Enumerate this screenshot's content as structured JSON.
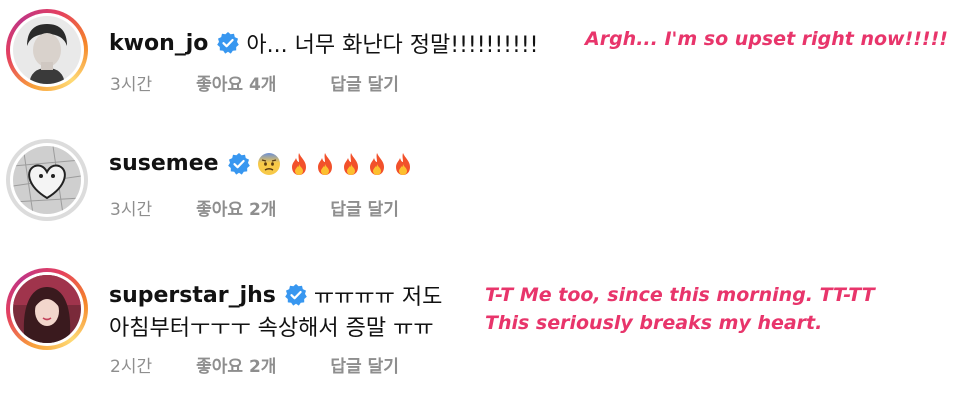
{
  "comments": [
    {
      "username": "kwon_jo",
      "text": "아... 너무 화난다  정말!!!!!!!!!!",
      "time": "3시간",
      "likes": "좋아요 4개",
      "reply": "답글 달기",
      "translation": "Argh... I'm so upset right now!!!!!",
      "avatar_ring": "story"
    },
    {
      "username": "susemee",
      "emoji": [
        "anxious-face-icon",
        "fire-icon",
        "fire-icon",
        "fire-icon",
        "fire-icon",
        "fire-icon"
      ],
      "time": "3시간",
      "likes": "좋아요 2개",
      "reply": "답글 달기",
      "avatar_ring": "plain"
    },
    {
      "username": "superstar_jhs",
      "text_line1": "ㅠㅠㅠㅠ 저도",
      "text_line2": "아침부터ㅜㅜㅜ 속상해서 증말 ㅠㅠ",
      "time": "2시간",
      "likes": "좋아요 2개",
      "reply": "답글 달기",
      "translation_line1": "T-T Me too, since this morning. TT-TT",
      "translation_line2": "This seriously breaks my heart.",
      "avatar_ring": "story"
    }
  ],
  "colors": {
    "verified": "#3897f0",
    "translation": "#e8356b",
    "meta": "#8e8e8e"
  }
}
